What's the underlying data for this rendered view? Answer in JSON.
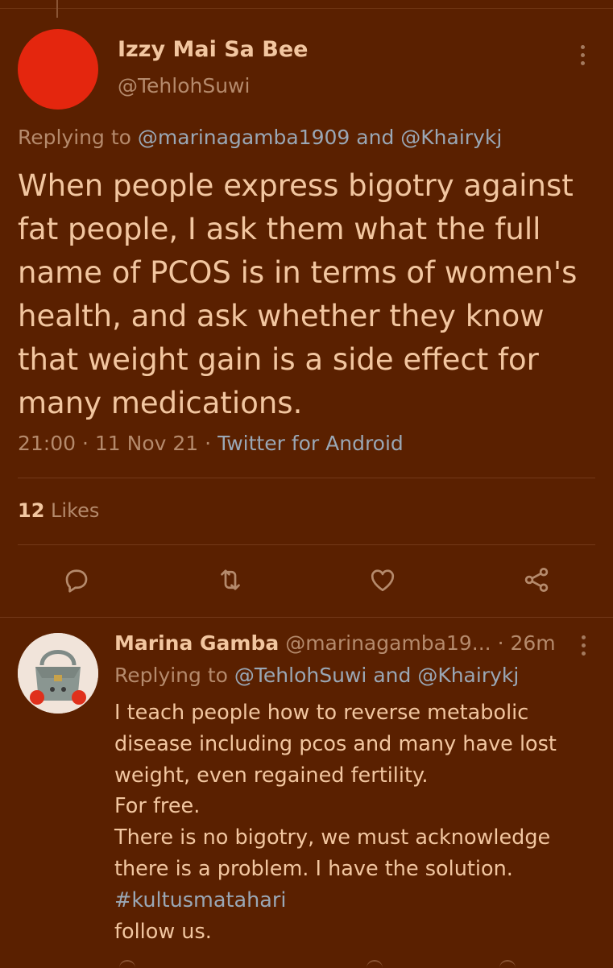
{
  "colors": {
    "background": "#5a2000",
    "text": "#f2c6a0",
    "muted": "#b58a6c",
    "link": "#9aa7b5",
    "avatar_red": "#e4260e"
  },
  "main_tweet": {
    "author_name": "Izzy Mai Sa Bee",
    "author_handle": "@TehlohSuwi",
    "replying_prefix": "Replying to",
    "replying_user1": "@marinagamba1909",
    "replying_and": "and",
    "replying_user2": "@Khairykj",
    "text": "When people express bigotry against fat people, I ask them what the full name of PCOS is in terms of women's health, and ask whether they know that weight gain is a side effect for many medications.",
    "time": "21:00",
    "date": "11 Nov 21",
    "separator": "·",
    "source": "Twitter for Android",
    "likes_count": "12",
    "likes_label": "Likes",
    "actions": [
      "reply-icon",
      "retweet-icon",
      "like-icon",
      "share-icon"
    ]
  },
  "reply_tweet": {
    "author_name": "Marina Gamba",
    "author_handle": "@marinagamba19...",
    "separator": "·",
    "time_ago": "26m",
    "replying_prefix": "Replying to",
    "replying_user1": "@TehlohSuwi",
    "replying_and": "and",
    "replying_user2": "@Khairykj",
    "lines": {
      "l1": "I teach people how to reverse metabolic",
      "l2": "disease including pcos and many have lost",
      "l3": "weight, even regained fertility.",
      "l4": "For free.",
      "l5": "There is no bigotry, we must acknowledge",
      "l6": "there is a problem. I have the solution.",
      "hashtag": "#kultusmatahari",
      "l8": "follow us."
    }
  }
}
